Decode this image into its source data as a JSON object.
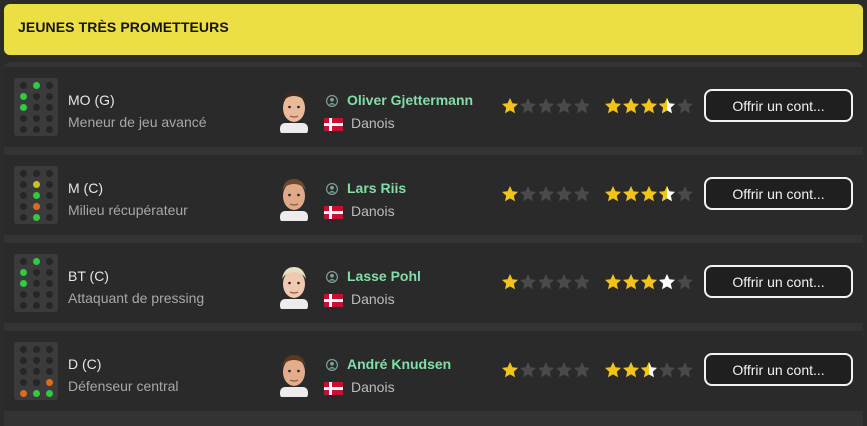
{
  "header": {
    "title": "JEUNES TRÈS PROMETTEURS"
  },
  "colors": {
    "header_bg": "#ecdf44",
    "name_color": "#7fe0a8",
    "star_gold": "#f2c318",
    "star_white": "#ffffff",
    "star_empty": "#4a4a4a",
    "dot_green": "#2ecc40",
    "dot_yellow": "#c9c21f",
    "dot_orange": "#e06a1c"
  },
  "players": [
    {
      "position": "MO (G)",
      "role": "Meneur de jeu avancé",
      "name": "Oliver Gjettermann",
      "nation": "Danois",
      "current_ability_stars": 1,
      "potential_ability_stars": 3.5,
      "potential_style": "gold",
      "offer_label": "Offrir un cont...",
      "pitch_dots": [
        {
          "r": 0,
          "c": 1,
          "s": "green"
        },
        {
          "r": 1,
          "c": 0,
          "s": "green"
        },
        {
          "r": 2,
          "c": 0,
          "s": "green"
        }
      ]
    },
    {
      "position": "M (C)",
      "role": "Milieu récupérateur",
      "name": "Lars Riis",
      "nation": "Danois",
      "current_ability_stars": 1,
      "potential_ability_stars": 3.5,
      "potential_style": "gold",
      "offer_label": "Offrir un cont...",
      "pitch_dots": [
        {
          "r": 1,
          "c": 1,
          "s": "yellow"
        },
        {
          "r": 2,
          "c": 1,
          "s": "green"
        },
        {
          "r": 3,
          "c": 1,
          "s": "orange"
        },
        {
          "r": 4,
          "c": 1,
          "s": "green"
        }
      ]
    },
    {
      "position": "BT (C)",
      "role": "Attaquant de pressing",
      "name": "Lasse Pohl",
      "nation": "Danois",
      "current_ability_stars": 1,
      "potential_ability_stars": 4,
      "potential_style": "gold-white",
      "offer_label": "Offrir un cont...",
      "pitch_dots": [
        {
          "r": 0,
          "c": 1,
          "s": "green"
        },
        {
          "r": 1,
          "c": 0,
          "s": "green"
        },
        {
          "r": 2,
          "c": 0,
          "s": "green"
        }
      ]
    },
    {
      "position": "D (C)",
      "role": "Défenseur central",
      "name": "André Knudsen",
      "nation": "Danois",
      "current_ability_stars": 1,
      "potential_ability_stars": 2.5,
      "potential_style": "gold",
      "offer_label": "Offrir un cont...",
      "pitch_dots": [
        {
          "r": 3,
          "c": 2,
          "s": "orange"
        },
        {
          "r": 4,
          "c": 0,
          "s": "orange"
        },
        {
          "r": 4,
          "c": 1,
          "s": "green"
        },
        {
          "r": 4,
          "c": 2,
          "s": "green"
        }
      ]
    }
  ]
}
